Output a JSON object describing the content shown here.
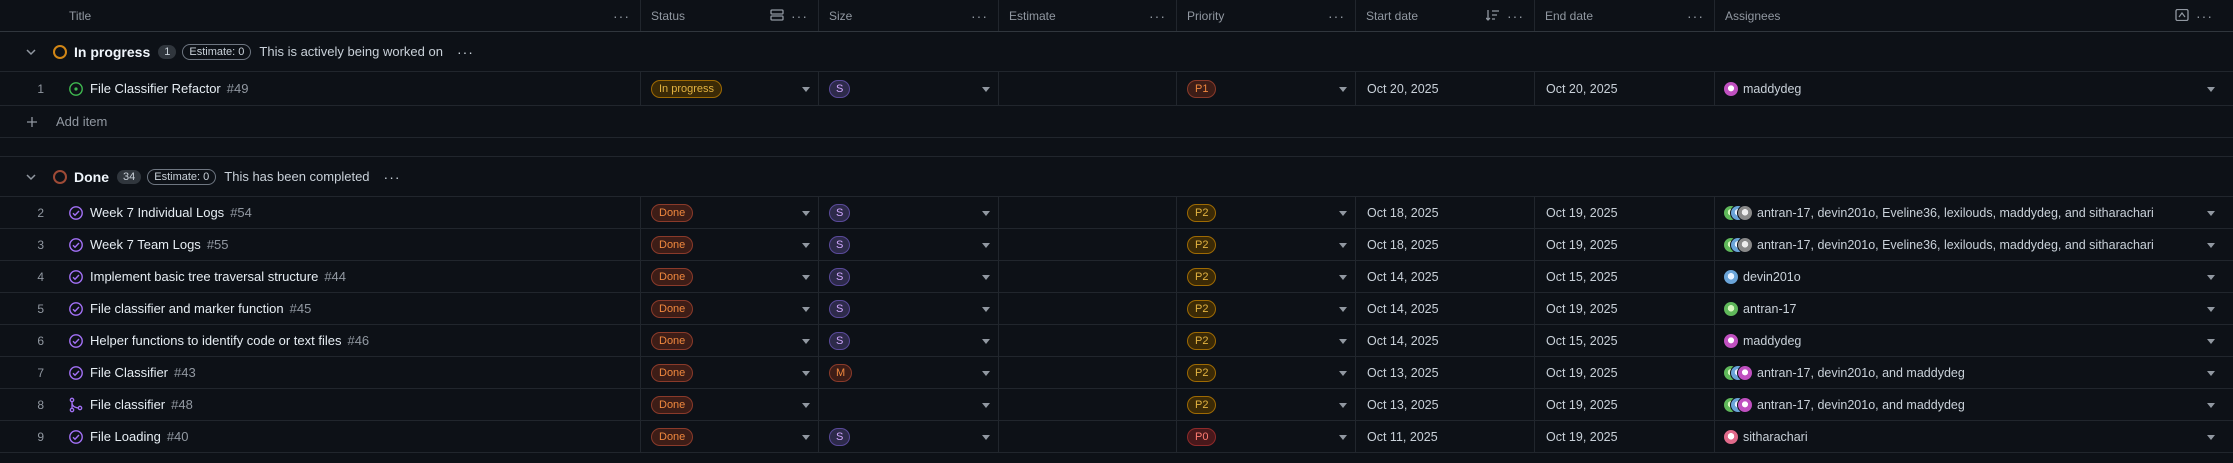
{
  "columns": {
    "title": "Title",
    "status": "Status",
    "size": "Size",
    "estimate": "Estimate",
    "priority": "Priority",
    "start_date": "Start date",
    "end_date": "End date",
    "assignees": "Assignees",
    "menu_glyph": "···"
  },
  "groups": [
    {
      "name": "In progress",
      "count": "1",
      "estimate": "Estimate: 0",
      "description": "This is actively being worked on",
      "menu_glyph": "···",
      "rows": [
        {
          "num": "1",
          "icon": "open-issue-icon",
          "title": "File Classifier Refactor",
          "issue": "#49",
          "status": "In progress",
          "size": "S",
          "estimate": "",
          "priority": "P1",
          "start": "Oct 20, 2025",
          "end": "Oct 20, 2025",
          "assignees": "maddydeg",
          "avatars": [
            "maddydeg"
          ]
        }
      ],
      "add_item": "Add item"
    },
    {
      "name": "Done",
      "count": "34",
      "estimate": "Estimate: 0",
      "description": "This has been completed",
      "menu_glyph": "···",
      "rows": [
        {
          "num": "2",
          "icon": "closed-issue-icon",
          "title": "Week 7 Individual Logs",
          "issue": "#54",
          "status": "Done",
          "size": "S",
          "estimate": "",
          "priority": "P2",
          "start": "Oct 18, 2025",
          "end": "Oct 19, 2025",
          "assignees": "antran-17, devin201o, Eveline36, lexilouds, maddydeg, and sitharachari",
          "avatars": [
            "antran",
            "devin",
            "eveline"
          ]
        },
        {
          "num": "3",
          "icon": "closed-issue-icon",
          "title": "Week 7 Team Logs",
          "issue": "#55",
          "status": "Done",
          "size": "S",
          "estimate": "",
          "priority": "P2",
          "start": "Oct 18, 2025",
          "end": "Oct 19, 2025",
          "assignees": "antran-17, devin201o, Eveline36, lexilouds, maddydeg, and sitharachari",
          "avatars": [
            "antran",
            "devin",
            "eveline"
          ]
        },
        {
          "num": "4",
          "icon": "closed-issue-icon",
          "title": "Implement basic tree traversal structure",
          "issue": "#44",
          "status": "Done",
          "size": "S",
          "estimate": "",
          "priority": "P2",
          "start": "Oct 14, 2025",
          "end": "Oct 15, 2025",
          "assignees": "devin201o",
          "avatars": [
            "devin"
          ]
        },
        {
          "num": "5",
          "icon": "closed-issue-icon",
          "title": "File classifier and marker function",
          "issue": "#45",
          "status": "Done",
          "size": "S",
          "estimate": "",
          "priority": "P2",
          "start": "Oct 14, 2025",
          "end": "Oct 19, 2025",
          "assignees": "antran-17",
          "avatars": [
            "antran"
          ]
        },
        {
          "num": "6",
          "icon": "closed-issue-icon",
          "title": "Helper functions to identify code or text files",
          "issue": "#46",
          "status": "Done",
          "size": "S",
          "estimate": "",
          "priority": "P2",
          "start": "Oct 14, 2025",
          "end": "Oct 15, 2025",
          "assignees": "maddydeg",
          "avatars": [
            "maddydeg"
          ]
        },
        {
          "num": "7",
          "icon": "closed-issue-icon",
          "title": "File Classifier",
          "issue": "#43",
          "status": "Done",
          "size": "M",
          "estimate": "",
          "priority": "P2",
          "start": "Oct 13, 2025",
          "end": "Oct 19, 2025",
          "assignees": "antran-17, devin201o, and maddydeg",
          "avatars": [
            "antran",
            "devin",
            "maddydeg"
          ]
        },
        {
          "num": "8",
          "icon": "merged-pr-icon",
          "title": "File classifier",
          "issue": "#48",
          "status": "Done",
          "size": "",
          "estimate": "",
          "priority": "P2",
          "start": "Oct 13, 2025",
          "end": "Oct 19, 2025",
          "assignees": "antran-17, devin201o, and maddydeg",
          "avatars": [
            "antran",
            "devin",
            "maddydeg"
          ]
        },
        {
          "num": "9",
          "icon": "closed-issue-icon",
          "title": "File Loading",
          "issue": "#40",
          "status": "Done",
          "size": "S",
          "estimate": "",
          "priority": "P0",
          "start": "Oct 11, 2025",
          "end": "Oct 19, 2025",
          "assignees": "sitharachari",
          "avatars": [
            "sitharachari"
          ]
        }
      ]
    }
  ],
  "colors": {
    "background": "#0d1117",
    "in_progress": "#d18616",
    "done": "#9e4a36",
    "done_icon": "#a371f7",
    "open_icon": "#3fb950"
  }
}
